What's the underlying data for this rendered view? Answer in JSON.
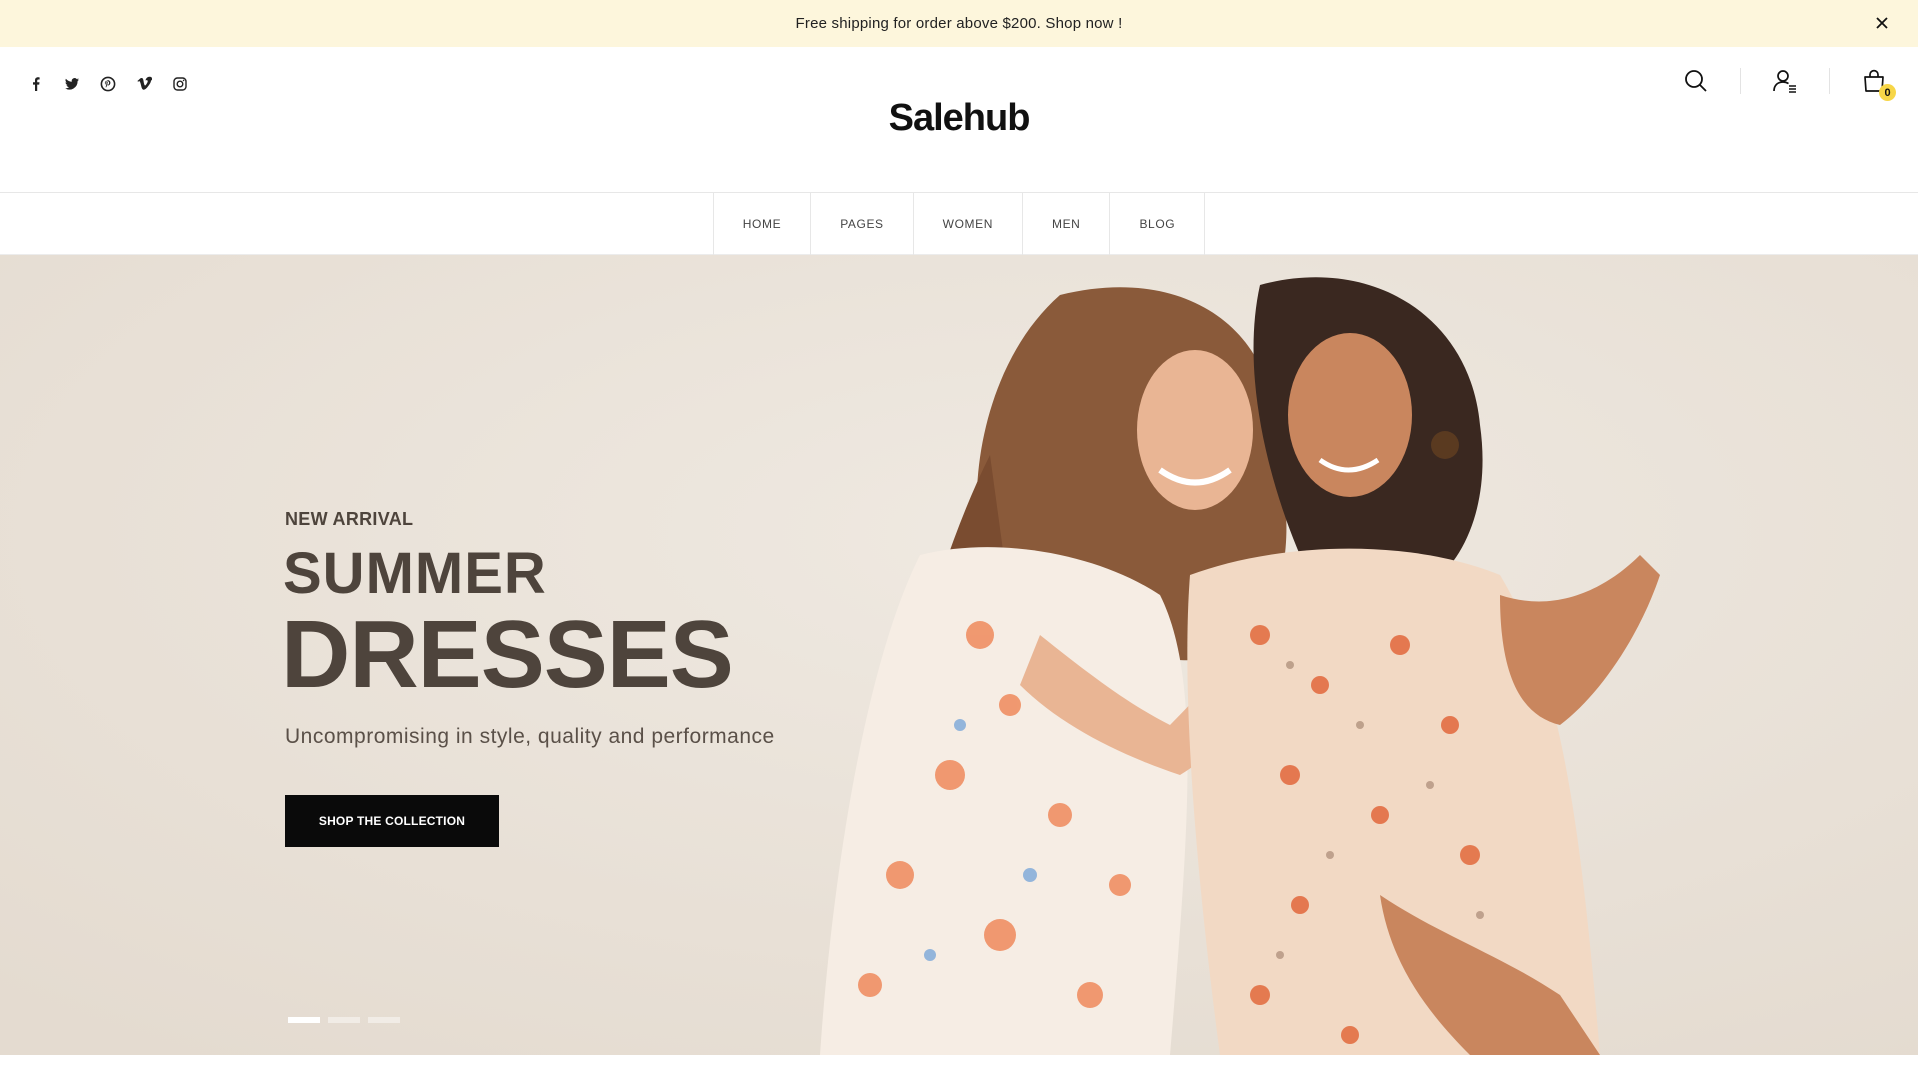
{
  "announcement": {
    "text": "Free shipping for order above $200. Shop now !",
    "close_icon": "close-icon"
  },
  "header": {
    "logo": "Salehub",
    "socials": [
      "facebook-icon",
      "twitter-icon",
      "pinterest-icon",
      "vimeo-icon",
      "instagram-icon"
    ],
    "actions": [
      "search-icon",
      "account-icon",
      "cart-icon"
    ],
    "cart_count": "0"
  },
  "nav": {
    "items": [
      {
        "label": "HOME"
      },
      {
        "label": "PAGES"
      },
      {
        "label": "WOMEN"
      },
      {
        "label": "MEN"
      },
      {
        "label": "BLOG"
      }
    ]
  },
  "hero": {
    "eyebrow": "NEW ARRIVAL",
    "title_line1": "SUMMER",
    "title_line2": "DRESSES",
    "subtitle": "Uncompromising in style, quality and performance",
    "cta": "SHOP THE COLLECTION",
    "slide_count": 3,
    "active_slide": 1
  },
  "colors": {
    "announcement_bg": "#fdf6dc",
    "hero_bg": "#e9e2d9",
    "hero_text": "#4e443c",
    "cta_bg": "#0a0a0a",
    "cart_badge": "#f7d648"
  }
}
